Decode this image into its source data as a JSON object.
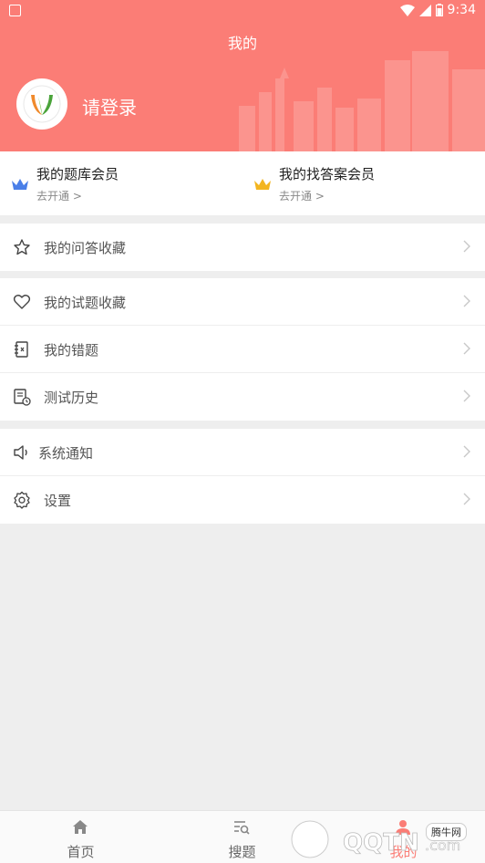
{
  "status_bar": {
    "time": "9:34"
  },
  "header": {
    "title": "我的",
    "login_text": "请登录"
  },
  "membership": [
    {
      "title": "我的题库会员",
      "sub": "去开通 >",
      "crown_color": "#4a7fe8"
    },
    {
      "title": "我的找答案会员",
      "sub": "去开通 >",
      "crown_color": "#f3b51f"
    }
  ],
  "menu": {
    "group1": [
      {
        "label": "我的问答收藏",
        "icon": "star-icon"
      }
    ],
    "group2": [
      {
        "label": "我的试题收藏",
        "icon": "heart-icon"
      },
      {
        "label": "我的错题",
        "icon": "notebook-icon"
      },
      {
        "label": "测试历史",
        "icon": "history-icon"
      }
    ],
    "group3": [
      {
        "label": "系统通知",
        "icon": "speaker-icon"
      },
      {
        "label": "设置",
        "icon": "gear-icon"
      }
    ]
  },
  "bottom_nav": [
    {
      "label": "首页",
      "icon": "home-icon"
    },
    {
      "label": "搜题",
      "icon": "search-list-icon"
    },
    {
      "label": "我的",
      "icon": "user-icon",
      "active": true
    }
  ],
  "watermark": {
    "badge": "腾牛网",
    "text": "QQTN.com"
  },
  "colors": {
    "accent": "#fb7d76",
    "background": "#eeeeee"
  }
}
